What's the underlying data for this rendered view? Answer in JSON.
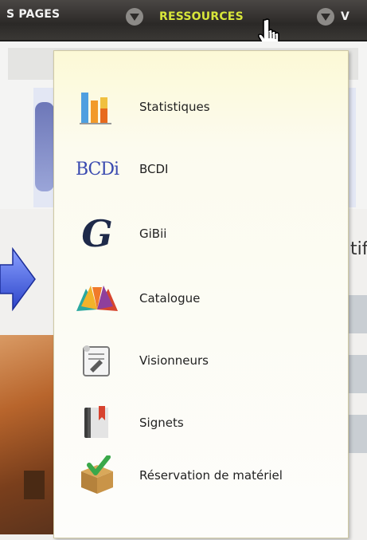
{
  "nav": {
    "item_pages": "S PAGES",
    "item_ressources": "RESSOURCES",
    "item_next": "V",
    "active_color": "#d8e63a"
  },
  "background": {
    "right_text": "tif"
  },
  "dropdown": {
    "items": [
      {
        "label": "Statistiques",
        "icon": "bar-chart-icon"
      },
      {
        "label": "BCDI",
        "icon": "bcdi-logo-icon"
      },
      {
        "label": "GiBii",
        "icon": "gibii-logo-icon"
      },
      {
        "label": "Catalogue",
        "icon": "open-book-icon"
      },
      {
        "label": "Visionneurs",
        "icon": "document-viewer-icon"
      },
      {
        "label": "Signets",
        "icon": "bookmark-book-icon"
      },
      {
        "label": "Réservation de matériel",
        "icon": "box-check-icon"
      }
    ],
    "bcdi_logo_text": "BCDi",
    "gibii_logo_text": "G"
  }
}
